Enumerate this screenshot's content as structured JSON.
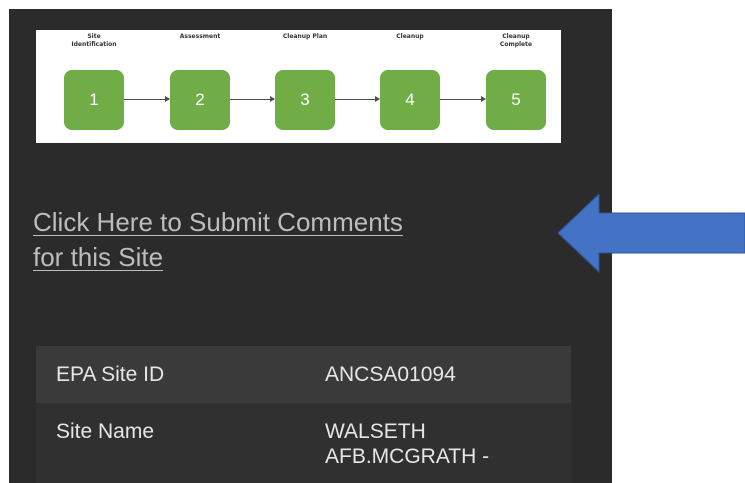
{
  "process": {
    "steps": [
      {
        "label": "Site\nIdentification",
        "number": "1"
      },
      {
        "label": "Assessment",
        "number": "2"
      },
      {
        "label": "Cleanup Plan",
        "number": "3"
      },
      {
        "label": "Cleanup",
        "number": "4"
      },
      {
        "label": "Cleanup\nComplete",
        "number": "5"
      }
    ],
    "box_color": "#70ad47"
  },
  "comment_link": {
    "line1": "Click Here to Submit Comments",
    "line2": "for this Site"
  },
  "site_info": {
    "rows": [
      {
        "key": "EPA Site ID",
        "value": "ANCSA01094"
      },
      {
        "key": "Site Name",
        "value_line1": "WALSETH",
        "value_line2": "AFB.MCGRATH -"
      }
    ]
  },
  "annotation": {
    "arrow_color": "#4472c4",
    "arrow_direction": "left"
  }
}
